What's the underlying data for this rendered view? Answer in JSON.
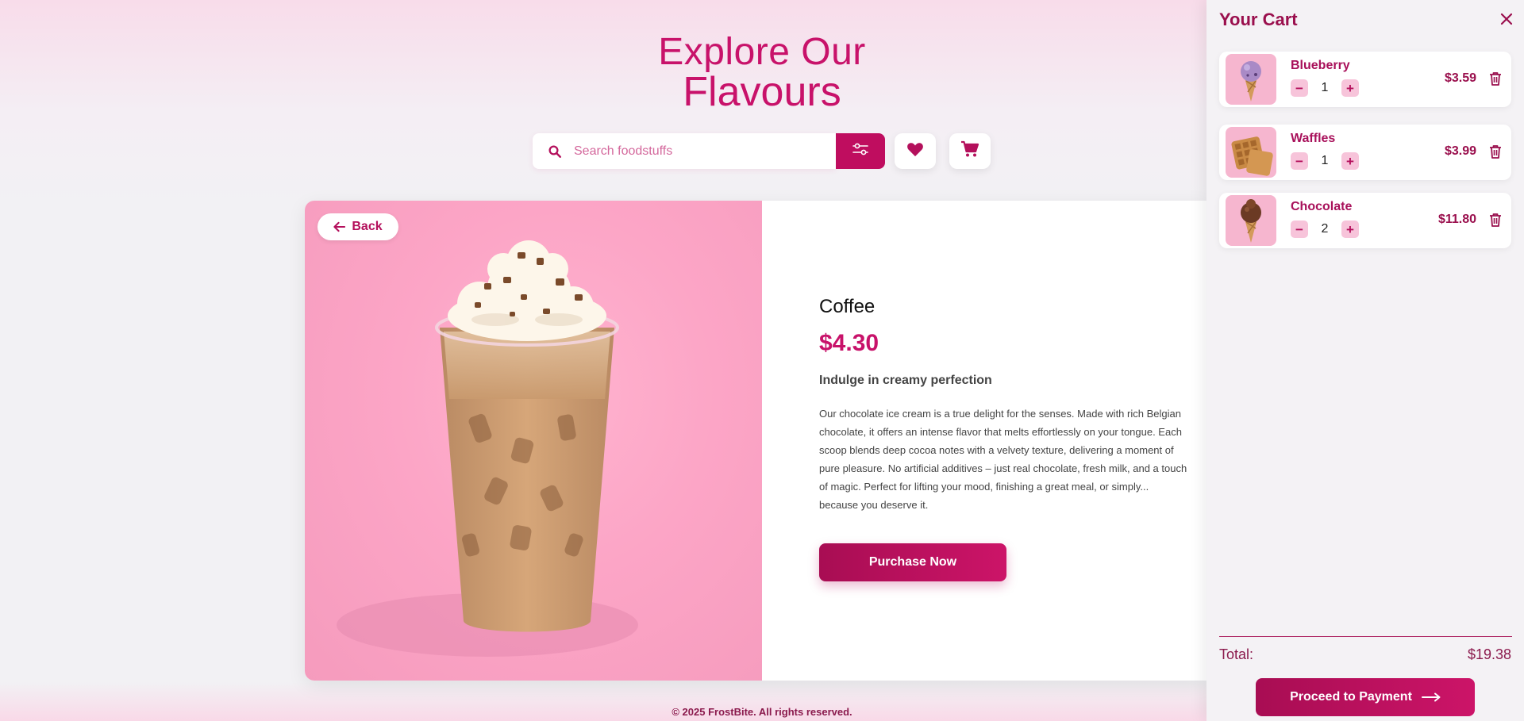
{
  "header": {
    "title_line1": "Explore Our",
    "title_line2": "Flavours"
  },
  "search": {
    "placeholder": "Search foodstuffs",
    "icon": "search-icon",
    "filter_icon": "sliders-icon"
  },
  "toolbar": {
    "favorites_icon": "heart-icon",
    "cart_icon": "cart-icon"
  },
  "product": {
    "back_label": "Back",
    "name": "Coffee",
    "price": "$4.30",
    "tagline": "Indulge in creamy perfection",
    "description": "Our chocolate ice cream is a true delight for the senses. Made with rich Belgian chocolate, it offers an intense flavor that melts effortlessly on your tongue. Each scoop blends deep cocoa notes with a velvety texture, delivering a moment of pure pleasure. No artificial additives – just real chocolate, fresh milk, and a touch of magic. Perfect for lifting your mood, finishing a great meal, or simply... because you deserve it.",
    "purchase_label": "Purchase Now",
    "image_icon": "iced-coffee-image"
  },
  "cart": {
    "title": "Your Cart",
    "close_icon": "close-icon",
    "items": [
      {
        "name": "Blueberry",
        "quantity": "1",
        "price": "$3.59",
        "thumb_icon": "ice-cream-cone-icon"
      },
      {
        "name": "Waffles",
        "quantity": "1",
        "price": "$3.99",
        "thumb_icon": "waffle-icon"
      },
      {
        "name": "Chocolate",
        "quantity": "2",
        "price": "$11.80",
        "thumb_icon": "ice-cream-cone-icon"
      }
    ],
    "minus": "−",
    "plus": "+",
    "total_label": "Total:",
    "total_value": "$19.38",
    "pay_label": "Proceed to Payment"
  },
  "footer": {
    "copyright": "© 2025 FrostBite. All rights reserved."
  },
  "colors": {
    "accent": "#c8126a",
    "accent_dark": "#9a0f4d",
    "qty_button_bg": "#f7c4da",
    "product_bg": "#fca5c6"
  }
}
